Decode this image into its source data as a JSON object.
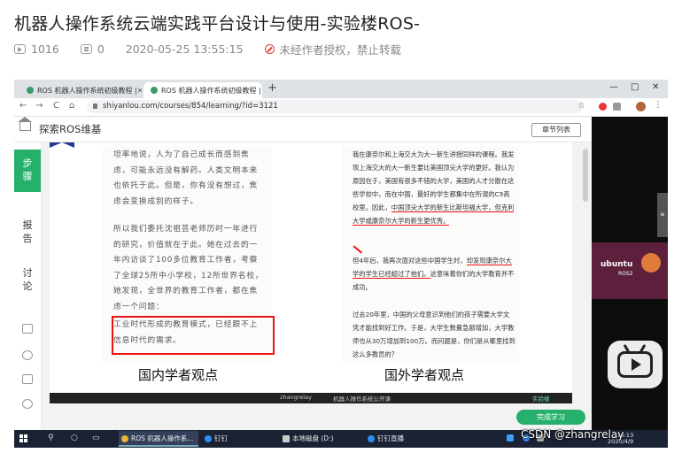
{
  "post": {
    "title": "机器人操作系统云端实践平台设计与使用-实验楼ROS-",
    "views": "1016",
    "comments": "0",
    "datetime": "2020-05-25 13:55:15",
    "license_note": "未经作者授权，禁止转载"
  },
  "browser": {
    "tabs": [
      {
        "label": "ROS 机器人操作系统初级教程 |"
      },
      {
        "label": "ROS 机器人操作系统初级教程 |"
      }
    ],
    "new_tab": "+",
    "window_controls": [
      "—",
      "□",
      "✕"
    ],
    "nav": [
      "←",
      "→",
      "C",
      "⌂"
    ],
    "url": "shiyanlou.com/courses/854/learning/?id=3121"
  },
  "page": {
    "title": "探索ROS维基",
    "chapters_button": "章节列表",
    "sidebar": {
      "step": "步骤",
      "report": "报告",
      "discuss": "讨论"
    },
    "complete_button": "完成学习"
  },
  "video": {
    "left_paragraphs": [
      "坦率地说，人为了自己成长而感到焦虑，可能永远没有解药。人类文明本来也依托于此。但是，你有没有想过，焦虑会变换成别的样子。",
      "所以我们委托沈祖芸老师历时一年进行的研究，价值就在于此。她在过去的一年内访谈了100多位教育工作者，考察了全球25所中小学校，12所世界名校，她发现，全世界的教育工作者，都在焦虑一个问题：",
      "工业时代形成的教育模式，已经跟不上信息时代的需求。"
    ],
    "right_paragraphs": [
      "我在康奈尔和上海交大为大一新生讲授同样的课程。我发现上海交大的大一新生要比美国顶尖大学的更好。我认为原因在于，美国有很多不错的大学，美国的人才分散在这些学校中，而在中国，最好的学生都集中在所谓的C9高校里。因此，",
      "中国顶尖大学的新生比斯坦福大学，但克利大学或康奈尔大学的新生更优秀。",
      "但4年后，我再次面对这些中国学生时，",
      "却发现康奈尔大学的学生已经超过了他们。",
      "这意味着你们的大学教育并不成功。",
      "过去20年里，中国的父母意识到他们的孩子需要大学文凭才能找到好工作。于是，大学生数量急剧增加，大学教师也从30万增加到100万。而问题是，你们是从哪里找到这么多教员的？"
    ],
    "left_caption": "国内学者观点",
    "right_caption": "国外学者观点",
    "bar_author": "zhangrelay",
    "bar_subtitle": "机器人操作系统公开课",
    "bar_logo": "实验楼"
  },
  "right_panel": {
    "thumb_title": "ubuntu",
    "thumb_sub": "ROS2",
    "collapse": "«"
  },
  "taskbar": {
    "apps": [
      {
        "label": "ROS 机器人操作系..."
      },
      {
        "label": "钉钉"
      },
      {
        "label": "本地磁盘 (D:)"
      },
      {
        "label": "钉钉直播"
      }
    ],
    "time": "18:13",
    "date": "2020/4/9"
  },
  "watermark": "CSDN @zhangrelay",
  "colors": {
    "accent_green": "#27b06b",
    "highlight_red": "#e11111",
    "taskbar": "#1a2234"
  }
}
